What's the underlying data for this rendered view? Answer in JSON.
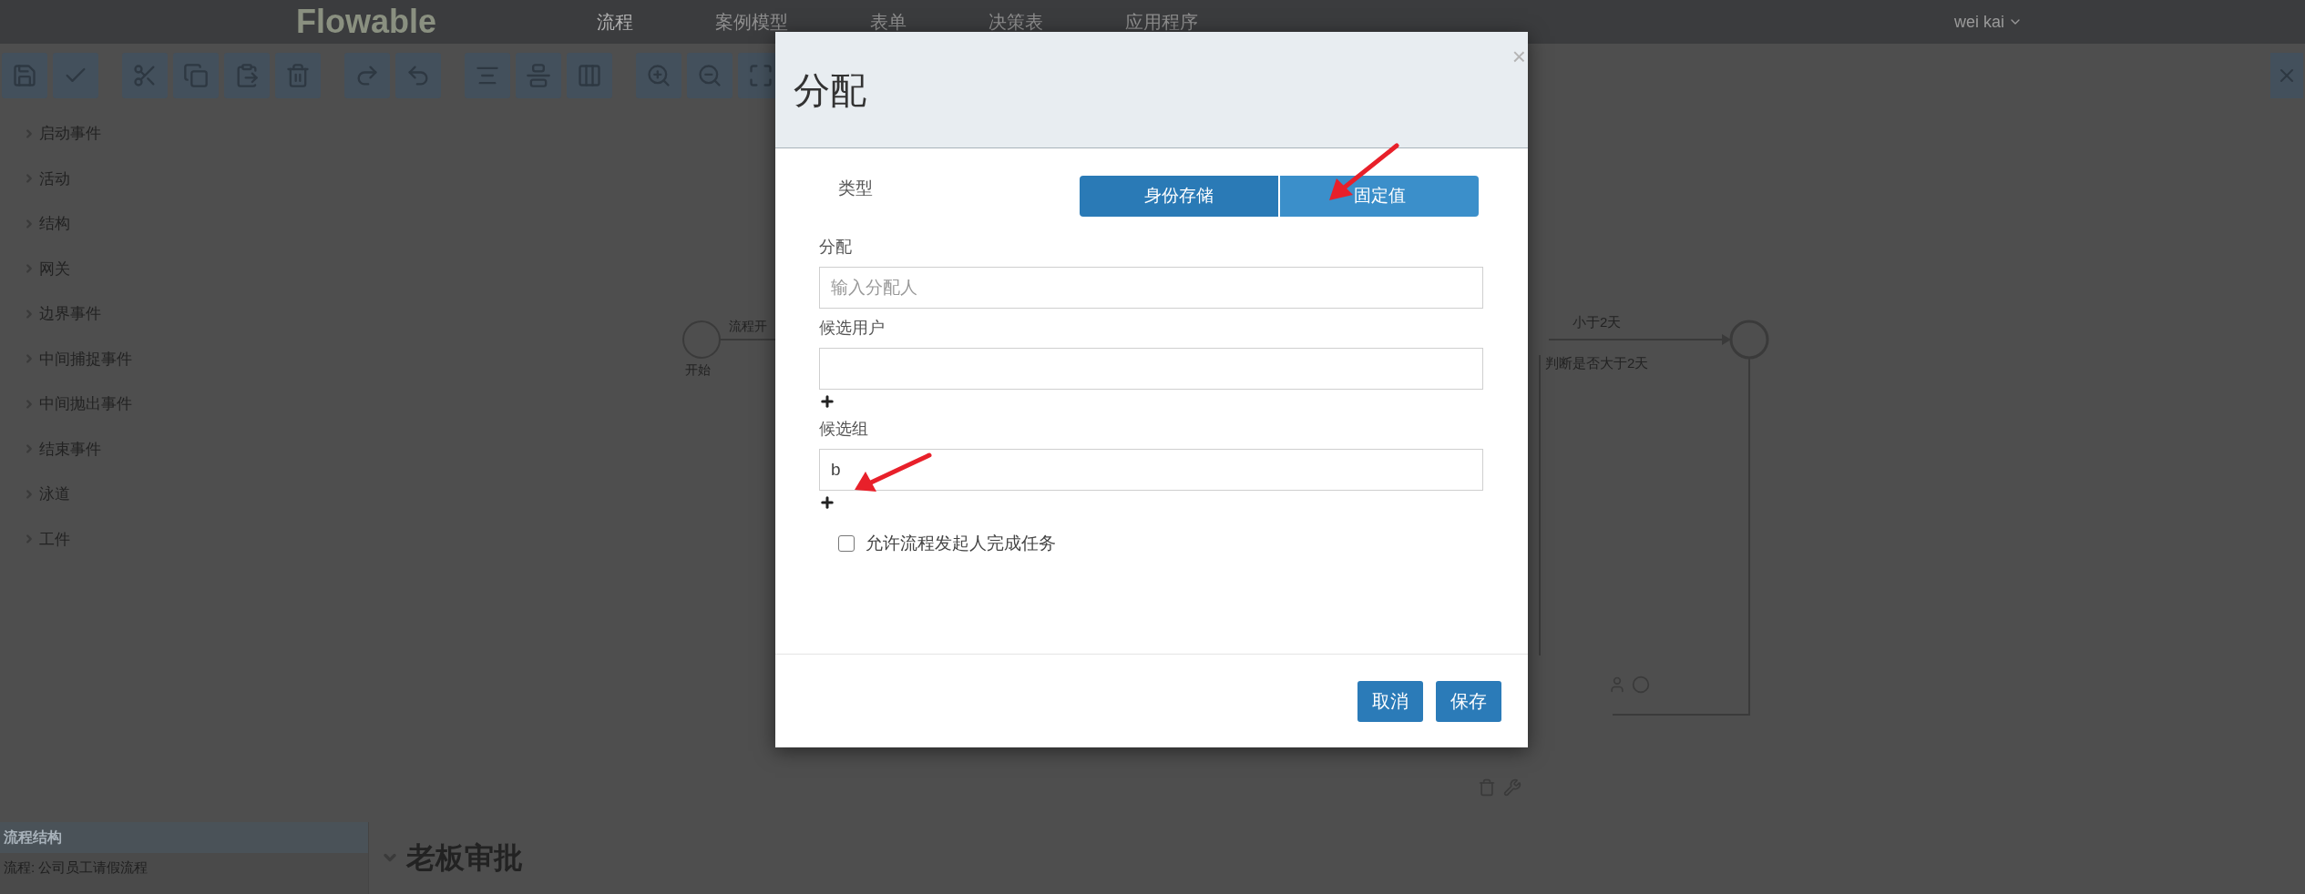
{
  "app": {
    "logo": "Flowable",
    "nav": [
      {
        "label": "流程",
        "selected": true
      },
      {
        "label": "案例模型",
        "selected": false
      },
      {
        "label": "表单",
        "selected": false
      },
      {
        "label": "决策表",
        "selected": false
      },
      {
        "label": "应用程序",
        "selected": false
      }
    ],
    "user": "wei kai"
  },
  "palette": {
    "groups": [
      "启动事件",
      "活动",
      "结构",
      "网关",
      "边界事件",
      "中间捕捉事件",
      "中间抛出事件",
      "结束事件",
      "泳道",
      "工件"
    ]
  },
  "diagram": {
    "start_label": "开始",
    "flow_label": "流程开",
    "gateway_flow_label": "小于2天",
    "gateway_label": "判断是否大于2天"
  },
  "properties": {
    "panel_title": "流程结构",
    "panel_row": "流程: 公司员工请假流程",
    "heading": "老板审批"
  },
  "dialog": {
    "title": "分配",
    "close": "×",
    "type_label": "类型",
    "type_options": [
      {
        "label": "身份存储",
        "selected": true
      },
      {
        "label": "固定值",
        "selected": false
      }
    ],
    "fields": [
      {
        "label": "分配",
        "placeholder": "输入分配人",
        "addable": false
      },
      {
        "label": "候选用户",
        "addable": true
      },
      {
        "label": "候选组",
        "value": "b",
        "addable": true
      }
    ],
    "checkbox": {
      "label": "允许流程发起人完成任务",
      "checked": false
    },
    "buttons": [
      "取消",
      "保存"
    ]
  }
}
